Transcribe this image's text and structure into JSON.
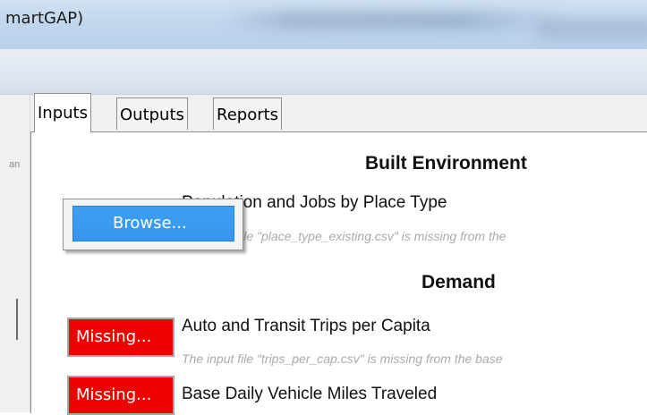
{
  "window": {
    "title": "martGAP)"
  },
  "left_panel": {
    "stub_text": "an"
  },
  "tabs": [
    {
      "label": "Inputs",
      "active": true
    },
    {
      "label": "Outputs",
      "active": false
    },
    {
      "label": "Reports",
      "active": false
    }
  ],
  "sections": [
    {
      "heading": "Built Environment",
      "items": [
        {
          "title": "Population and Jobs by Place Type",
          "title_visible": "P​          lation and Jobs by Place Type",
          "description": "The input file \"place_type_existing.csv\" is missing from the",
          "description_visible": "t file \"place_type_existing.csv\" is missing from the"
        }
      ]
    },
    {
      "heading": "Demand",
      "items": [
        {
          "title": "Auto and Transit Trips per Capita",
          "description": "The input file \"trips_per_cap.csv\" is missing from the base",
          "button_label": "Missing..."
        },
        {
          "title": "Base Daily Vehicle Miles Traveled",
          "button_label": "Missing..."
        }
      ]
    }
  ],
  "popup": {
    "item_label": "Browse..."
  },
  "colors": {
    "missing_button": "#ee0000",
    "popup_highlight": "#3d9ff2",
    "titlebar": "#c2d7ee"
  }
}
